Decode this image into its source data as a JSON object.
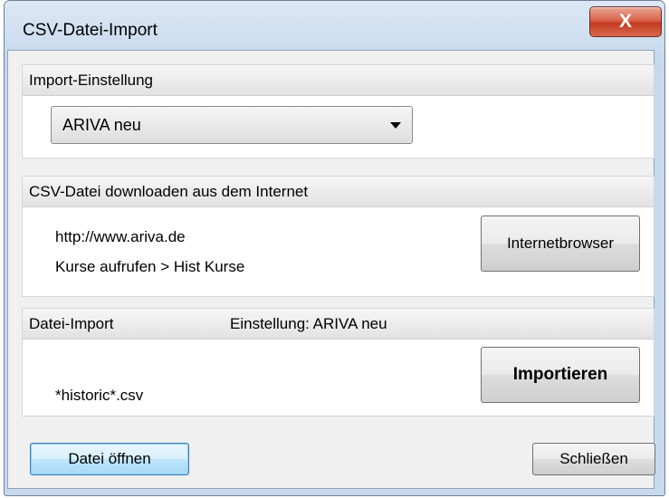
{
  "window": {
    "title": "CSV-Datei-Import",
    "close_glyph": "X"
  },
  "import_settings": {
    "header": "Import-Einstellung",
    "selected": "ARIVA neu"
  },
  "download": {
    "header": "CSV-Datei downloaden aus dem Internet",
    "url": "http://www.ariva.de",
    "instructions": "Kurse aufrufen > Hist Kurse",
    "browser_button": "Internetbrowser"
  },
  "file_import": {
    "header": "Datei-Import",
    "setting_label": "Einstellung:  ARIVA neu",
    "file_pattern": "*historic*.csv",
    "import_button": "Importieren"
  },
  "footer": {
    "open_button": "Datei öffnen",
    "close_button": "Schließen"
  },
  "colors": {
    "close_button": "#c43a20",
    "default_button_border": "#3c7fb1",
    "titlebar": "#c4d7ec",
    "client_bg": "#f0f0f0"
  }
}
